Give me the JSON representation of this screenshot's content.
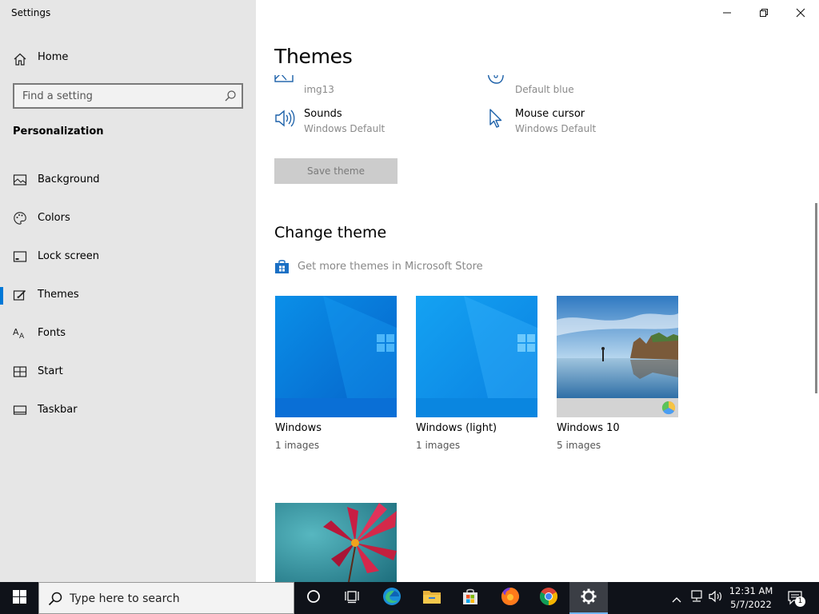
{
  "window": {
    "app_title": "Settings",
    "minimize_icon": "minimize-icon",
    "restore_icon": "restore-icon",
    "close_icon": "close-icon"
  },
  "sidebar": {
    "home_label": "Home",
    "search_placeholder": "Find a setting",
    "section_title": "Personalization",
    "items": [
      {
        "label": "Background",
        "icon": "background-icon",
        "active": false
      },
      {
        "label": "Colors",
        "icon": "palette-icon",
        "active": false
      },
      {
        "label": "Lock screen",
        "icon": "lock-screen-icon",
        "active": false
      },
      {
        "label": "Themes",
        "icon": "themes-icon",
        "active": true
      },
      {
        "label": "Fonts",
        "icon": "fonts-icon",
        "active": false
      },
      {
        "label": "Start",
        "icon": "start-icon",
        "active": false
      },
      {
        "label": "Taskbar",
        "icon": "taskbar-icon",
        "active": false
      }
    ]
  },
  "main": {
    "page_title": "Themes",
    "properties": [
      {
        "name": "",
        "value": "img13",
        "icon": "background-image-icon"
      },
      {
        "name": "",
        "value": "Default blue",
        "icon": "color-icon"
      },
      {
        "name": "Sounds",
        "value": "Windows Default",
        "icon": "sound-icon"
      },
      {
        "name": "Mouse cursor",
        "value": "Windows Default",
        "icon": "mouse-cursor-icon"
      }
    ],
    "save_theme_label": "Save theme",
    "change_theme_heading": "Change theme",
    "store_link_label": "Get more themes in Microsoft Store",
    "themes": [
      {
        "name": "Windows",
        "count": "1 images"
      },
      {
        "name": "Windows (light)",
        "count": "1 images"
      },
      {
        "name": "Windows 10",
        "count": "5 images"
      }
    ],
    "accent_color": "#0078d7"
  },
  "taskbar": {
    "search_placeholder": "Type here to search",
    "apps": [
      "cortana-icon",
      "task-view-icon",
      "edge-icon",
      "file-explorer-icon",
      "microsoft-store-icon",
      "firefox-icon",
      "chrome-icon",
      "settings-icon"
    ],
    "clock_time": "12:31 AM",
    "clock_date": "5/7/2022",
    "notification_count": "1"
  }
}
